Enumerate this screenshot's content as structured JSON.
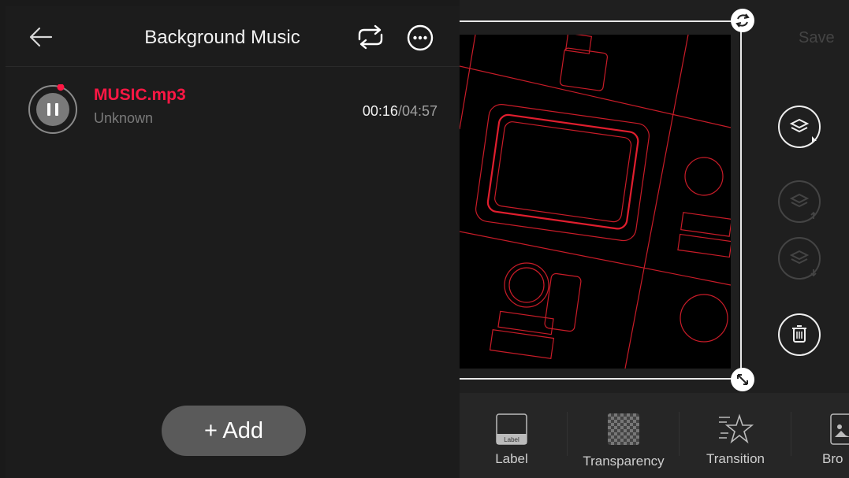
{
  "header": {
    "title": "Background Music"
  },
  "track": {
    "name": "MUSIC.mp3",
    "artist": "Unknown",
    "elapsed": "00:16",
    "separator": "/",
    "total": "04:57",
    "progress": 0.054
  },
  "add_button": "+ Add",
  "editor": {
    "save_label": "Save",
    "tools": [
      {
        "label": "Label",
        "icon": "label-icon",
        "icon_text": "Label"
      },
      {
        "label": "Transparency",
        "icon": "transparency-icon"
      },
      {
        "label": "Transition",
        "icon": "transition-icon"
      },
      {
        "label": "Bro",
        "icon": "image-icon"
      }
    ]
  },
  "colors": {
    "accent": "#ff1744",
    "background": "#1c1c1c",
    "outline": "#e01e2e"
  },
  "icons": [
    "back-arrow-icon",
    "loop-icon",
    "more-icon",
    "pause-icon",
    "rotate-icon",
    "resize-icon",
    "layers-select-icon",
    "layer-up-icon",
    "layer-down-icon",
    "trash-icon"
  ]
}
